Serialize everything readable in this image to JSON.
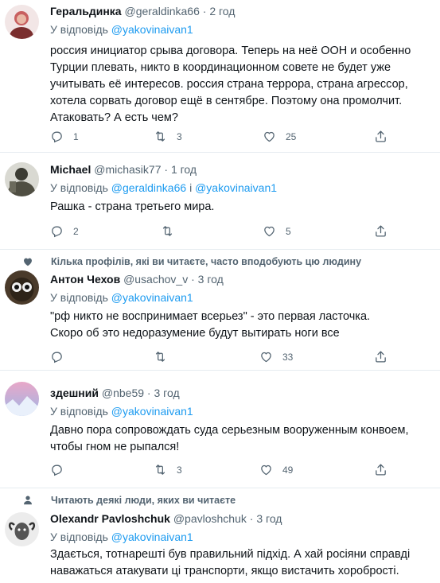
{
  "reply_prefix": "У відповідь",
  "and_word": "і",
  "tweets": [
    {
      "name": "Геральдинка",
      "handle": "@geraldinka66",
      "time": "2 год",
      "reply_to": [
        "@yakovinaivan1"
      ],
      "lines": [
        "россия инициатор срыва договора. Теперь на неё ООН и особенно",
        "Турции плевать, никто в координационном совете не будет уже",
        "учитывать её интересов. россия страна террора, страна агрессор,",
        "хотела сорвать договор ещё в сентябре. Поэтому она промолчит.",
        "Атаковать? А есть чем?"
      ],
      "replies": "1",
      "retweets": "3",
      "likes": "25"
    },
    {
      "name": "Michael",
      "handle": "@michasik77",
      "time": "1 год",
      "reply_to": [
        "@geraldinka66",
        "@yakovinaivan1"
      ],
      "lines": [
        "Рашка - страна третьего мира."
      ],
      "replies": "2",
      "retweets": "",
      "likes": "5"
    },
    {
      "social": "Кілька профілів, які ви читаєте, часто вподобують цю людину",
      "name": "Антон Чехов",
      "handle": "@usachov_v",
      "time": "3 год",
      "reply_to": [
        "@yakovinaivan1"
      ],
      "lines": [
        "\"рф никто не воспринимает всерьез\" - это первая ласточка.",
        "Скоро об это недоразумение будут вытирать ноги все"
      ],
      "replies": "",
      "retweets": "",
      "likes": "33"
    },
    {
      "name": "здешний",
      "handle": "@nbe59",
      "time": "3 год",
      "reply_to": [
        "@yakovinaivan1"
      ],
      "lines": [
        "Давно пора сопровождать суда серьезным вооруженным конвоем,",
        "чтобы гном не рыпался!"
      ],
      "replies": "",
      "retweets": "3",
      "likes": "49"
    },
    {
      "social": "Читають деякі люди, яких ви читаєте",
      "name": "Olexandr Pavloshchuk",
      "handle": "@pavloshchuk",
      "time": "3 год",
      "reply_to": [
        "@yakovinaivan1"
      ],
      "lines": [
        "Здається, тотнарешті був правильний підхід. А хай росіяни справді",
        "наважаться атакувати ці транспорти, якщо вистачить хоробрості."
      ],
      "replies": "",
      "retweets": "",
      "likes": ""
    }
  ],
  "icons": {
    "reply": "reply-icon",
    "retweet": "retweet-icon",
    "like": "like-icon",
    "share": "share-icon",
    "heart_small": "heart-icon",
    "person_small": "person-icon"
  },
  "colors": {
    "link": "#1d9bf0",
    "muted": "#536471",
    "divider": "#e6ecf0"
  }
}
